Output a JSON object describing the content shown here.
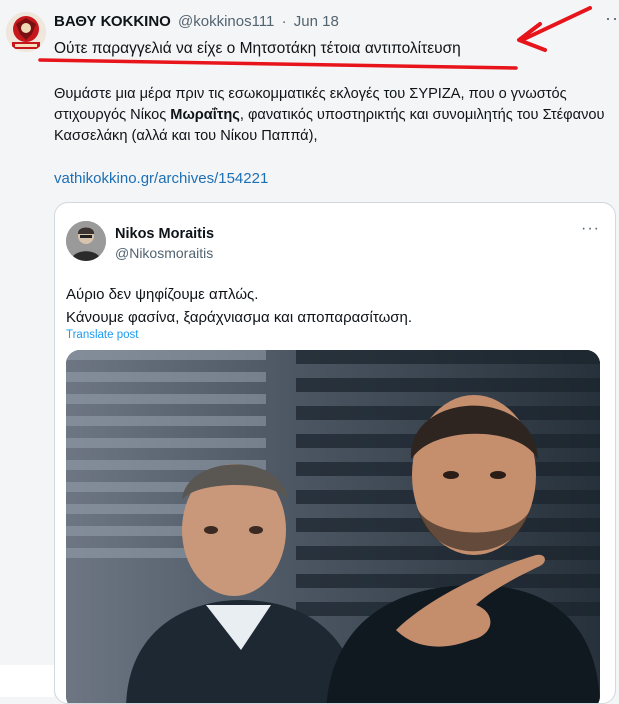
{
  "tweet": {
    "author_name": "ΒΑΘΥ ΚΟΚΚΙΝΟ",
    "author_handle": "@kokkinos111",
    "separator": "·",
    "timestamp": "Jun 18",
    "more": "···",
    "headline": "Ούτε παραγγελιά να είχε ο Μητσοτάκη τέτοια αντιπολίτευση",
    "body_part1": "Θυμάστε μια μέρα πριν τις εσωκομματικές εκλογές του ΣΥΡΙΖΑ, που ο γνωστός στιχουργός Νίκος ",
    "body_bold": "Μωραΐτης",
    "body_part2": ", φανατικός υποστηρικτής και συνομιλητής του Στέφανου Κασσελάκη (αλλά και του Νίκου Παππά),",
    "link": "vathikokkino.gr/archives/154221"
  },
  "quoted": {
    "author_name": "Nikos Moraitis",
    "author_handle": "@Nikosmoraitis",
    "more": "···",
    "line1": "Αύριο δεν ψηφίζουμε απλώς.",
    "line2": "Κάνουμε φασίνα, ξαράχνιασμα και αποπαρασίτωση.",
    "translate": "Translate post"
  },
  "colors": {
    "annotation_red": "#e8141b",
    "link_blue": "#1d6fb4",
    "translate_blue": "#1d9bf0",
    "muted_text": "#536471"
  }
}
